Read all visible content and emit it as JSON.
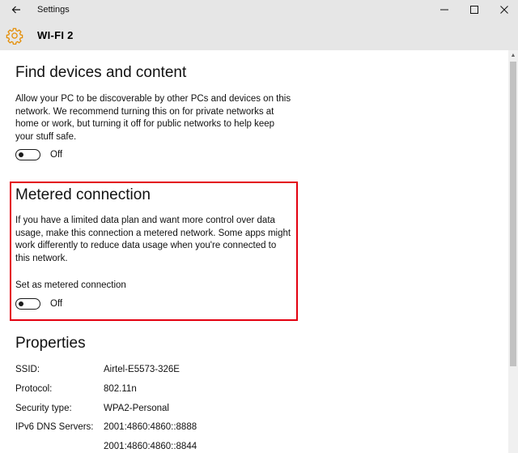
{
  "window": {
    "app_title": "Settings",
    "controls": [
      "minimize-icon",
      "maximize-icon",
      "close-icon"
    ]
  },
  "header": {
    "icon": "gear-icon",
    "title": "WI-FI 2"
  },
  "find_devices": {
    "heading": "Find devices and content",
    "lines": [
      "Allow your PC to be discoverable by other PCs and devices on this",
      "network. We recommend turning this on for private networks at",
      "home or work, but turning it off for public networks to help keep",
      "your stuff safe."
    ],
    "toggle_state": "Off"
  },
  "metered": {
    "heading": "Metered connection",
    "lines": [
      "If you have a limited data plan and want more control over data",
      "usage, make this connection a metered network. Some apps might",
      "work differently to reduce data usage when you're connected to",
      "this network."
    ],
    "setting_label": "Set as metered connection",
    "toggle_state": "Off",
    "highlight_color": "#e3000f"
  },
  "properties": {
    "heading": "Properties",
    "rows": [
      {
        "label": "SSID:",
        "value": "Airtel-E5573-326E"
      },
      {
        "label": "Protocol:",
        "value": "802.11n"
      },
      {
        "label": "Security type:",
        "value": "WPA2-Personal"
      },
      {
        "label": "IPv6 DNS Servers:",
        "value": "2001:4860:4860::8888"
      },
      {
        "label": "",
        "value": "2001:4860:4860::8844"
      }
    ]
  }
}
